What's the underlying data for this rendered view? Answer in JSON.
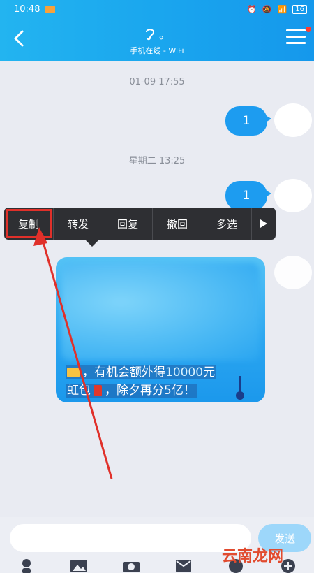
{
  "status": {
    "time": "10:48",
    "battery": "16"
  },
  "header": {
    "title": "。",
    "subtitle": "手机在线 - WiFi"
  },
  "messages": {
    "ts1": "01-09 17:55",
    "msg1": "1",
    "ts2": "星期二 13:25",
    "msg2": "1",
    "big_line1_prefix": "，有机会额外得",
    "big_line1_link": "10000",
    "big_line1_suffix": "元",
    "big_line2_prefix": "虹包",
    "big_line2_suffix": "，除夕再分5亿！"
  },
  "context_menu": {
    "items": [
      "复制",
      "转发",
      "回复",
      "撤回",
      "多选"
    ]
  },
  "input": {
    "send_label": "发送"
  },
  "colors": {
    "primary": "#1d9cf0",
    "menu_bg": "#2e2f33",
    "highlight": "#e0302a"
  },
  "watermark": "云南龙网"
}
